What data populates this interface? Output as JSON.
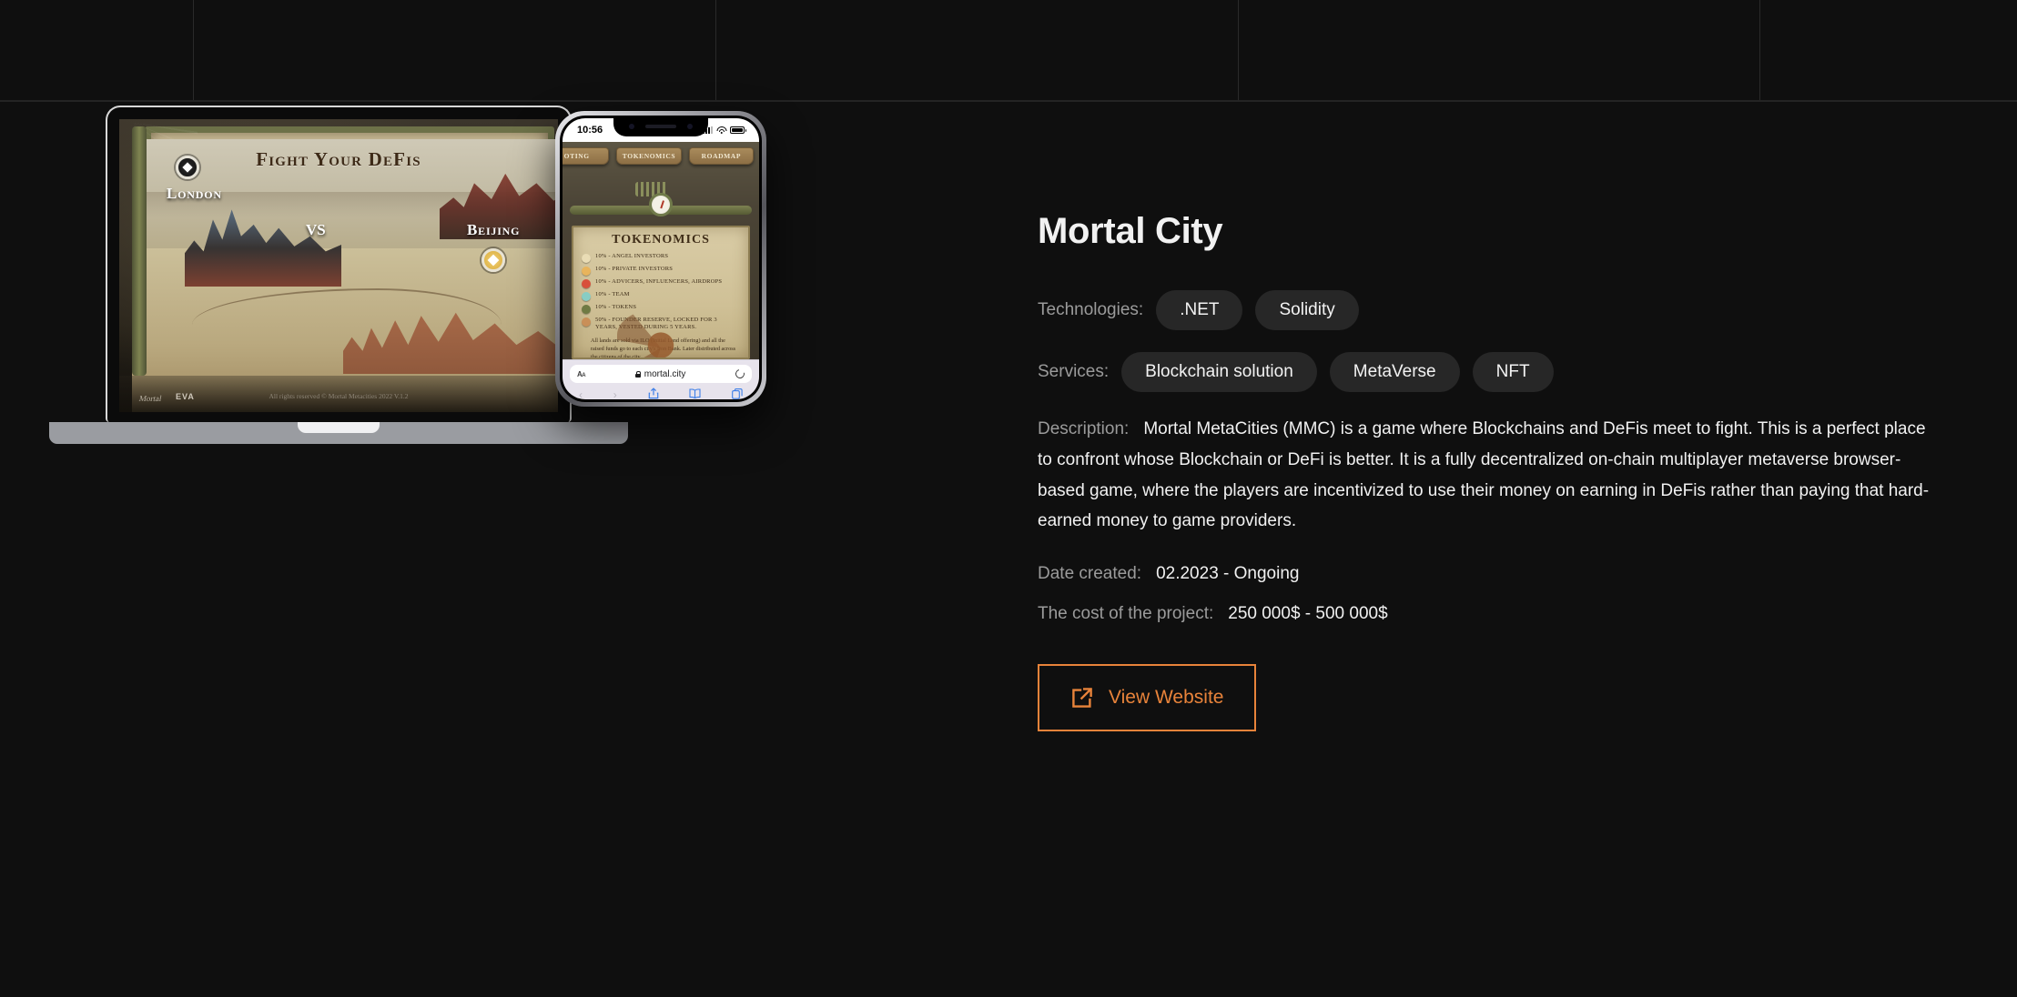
{
  "background": {
    "page_color": "#0f0f0f",
    "grid_line_color": "#2a2a2a",
    "accent_color": "#e8833a",
    "chip_color": "#272727",
    "label_color": "#9b9b9b"
  },
  "project": {
    "title": "Mortal City",
    "technologies_label": "Technologies:",
    "technologies": [
      ".NET",
      "Solidity"
    ],
    "services_label": "Services:",
    "services": [
      "Blockchain solution",
      "MetaVerse",
      "NFT"
    ],
    "description_label": "Description:",
    "description": "Mortal MetaCities (MMC) is a game where Blockchains and DeFis meet to fight. This is a perfect place to confront whose Blockchain or DeFi is better. It is a fully decentralized on-chain multiplayer metaverse browser-based game, where the players are incentivized to use their money on earning in DeFis rather than paying that hard-earned money to game providers.",
    "date_label": "Date created:",
    "date_value": "02.2023 - Ongoing",
    "cost_label": "The cost of the project:",
    "cost_value": "250 000$ - 500 000$",
    "cta_label": "View Website",
    "cta_icon": "external-link-icon"
  },
  "laptop_mockup": {
    "game_title": "Fight Your DeFis",
    "left_city": "London",
    "versus": "VS",
    "right_city": "Beijing",
    "brand": "EVA",
    "watermark": "Mortal",
    "copyright": "All rights reserved © Mortal Metacities 2022 V.1.2"
  },
  "phone_mockup": {
    "status_time": "10:56",
    "status_icons": [
      "cellular-signal-icon",
      "wifi-icon",
      "battery-icon"
    ],
    "nav_tabs": [
      "OTING",
      "TOKENOMICS",
      "ROADMAP"
    ],
    "section_title": "TOKENOMICS",
    "tokenomics": [
      {
        "percent": "10%",
        "label": "10% - ANGEL INVESTORS",
        "color": "#e9dcb5"
      },
      {
        "percent": "10%",
        "label": "10% - PRIVATE INVESTORS",
        "color": "#e8b45c"
      },
      {
        "percent": "10%",
        "label": "10% - ADVICERS, INFLUENCERS, AIRDROPS",
        "color": "#d8503a"
      },
      {
        "percent": "10%",
        "label": "10% - TEAM",
        "color": "#88cdc4"
      },
      {
        "percent": "10%",
        "label": "10% - TOKENS",
        "color": "#6f7a43"
      },
      {
        "percent": "50%",
        "label": "50% - FOUNDER RESERVE, LOCKED FOR 3 YEARS, VESTED DURING 5 YEARS.",
        "color": "#c98f58"
      }
    ],
    "note": "All lands are sold via ILO (Initial Land offering) and all the raised funds go to each city's Iron Bank. Later distributed across the citizens of the city.",
    "browser": {
      "text_size_control": "AA",
      "lock_icon": "lock-icon",
      "url": "mortal.city",
      "reload_icon": "reload-icon",
      "back_icon": "‹",
      "forward_icon": "›",
      "share_icon": "⇪",
      "bookmarks_icon": "bookmarks-icon",
      "tabs_icon": "tabs-icon"
    }
  }
}
